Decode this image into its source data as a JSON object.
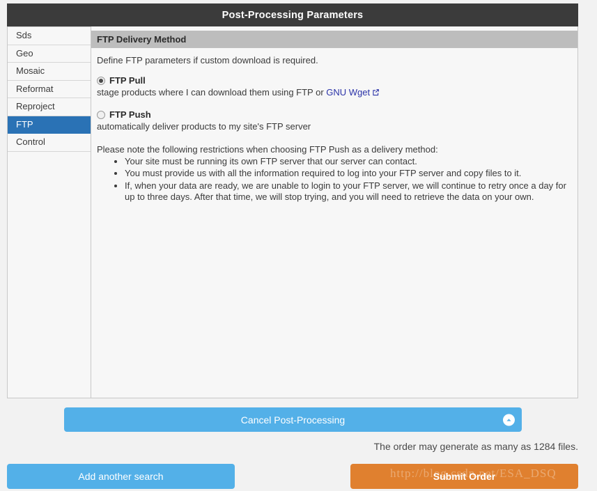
{
  "window": {
    "title": "Post-Processing Parameters"
  },
  "sidebar": {
    "items": [
      {
        "label": "Sds",
        "active": false
      },
      {
        "label": "Geo",
        "active": false
      },
      {
        "label": "Mosaic",
        "active": false
      },
      {
        "label": "Reformat",
        "active": false
      },
      {
        "label": "Reproject",
        "active": false
      },
      {
        "label": "FTP",
        "active": true
      },
      {
        "label": "Control",
        "active": false
      }
    ]
  },
  "main": {
    "section_title": "FTP Delivery Method",
    "intro": "Define FTP parameters if custom download is required.",
    "options": [
      {
        "label": "FTP Pull",
        "desc_prefix": "stage products where I can download them using FTP or ",
        "link_text": "GNU Wget",
        "link_icon": "external-link-icon",
        "selected": true
      },
      {
        "label": "FTP Push",
        "desc_prefix": "automatically deliver products to my site's FTP server",
        "link_text": "",
        "link_icon": "",
        "selected": false
      }
    ],
    "restrictions_intro": "Please note the following restrictions when choosing FTP Push as a delivery method:",
    "restrictions": [
      "Your site must be running its own FTP server that our server can contact.",
      "You must provide us with all the information required to log into your FTP server and copy files to it.",
      "If, when your data are ready, we are unable to login to your FTP server, we will continue to retry once a day for up to three days. After that time, we will stop trying, and you will need to retrieve the data on your own."
    ]
  },
  "footer": {
    "cancel_label": "Cancel Post-Processing",
    "cancel_icon": "chevron-up-circle-icon",
    "file_count_text": "The order may generate as many as 1284 files.",
    "add_search_label": "Add another search",
    "submit_label": "Submit Order"
  },
  "overlay": {
    "watermark_text": "http://blog.csdn.net/ESA_DSQ"
  },
  "colors": {
    "header_bg": "#3b3b3b",
    "section_bg": "#bdbdbd",
    "active_tab": "#2a72b5",
    "primary_button": "#53b0e8",
    "submit_button": "#e0802f",
    "link": "#2b33a8"
  }
}
